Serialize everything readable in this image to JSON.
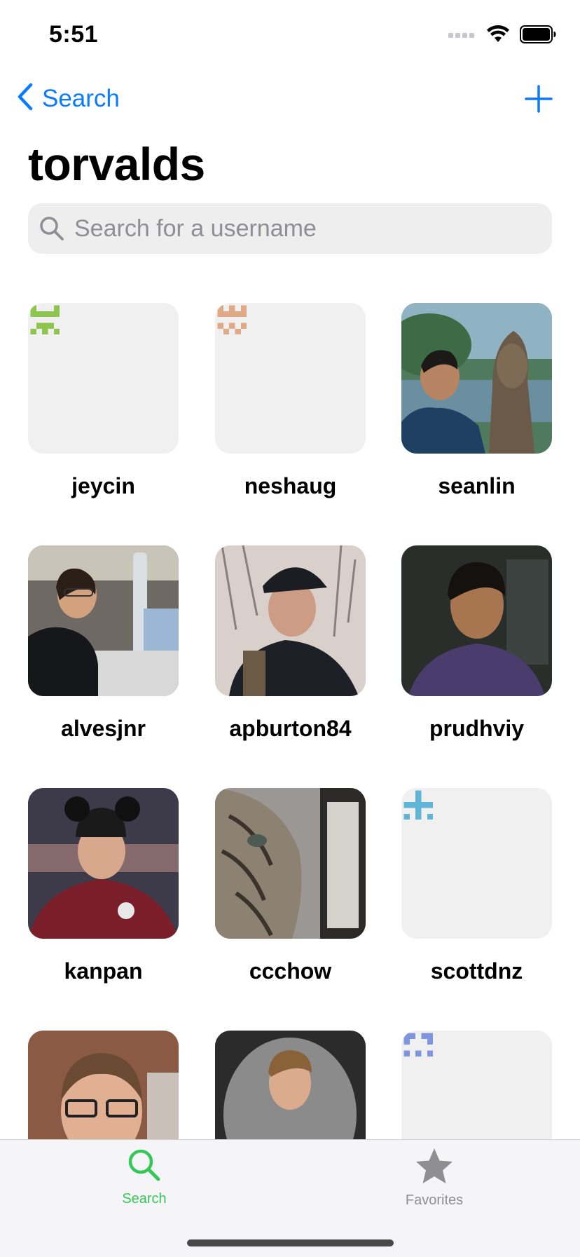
{
  "status_bar": {
    "time": "5:51"
  },
  "nav": {
    "back_label": "Search",
    "title": "torvalds"
  },
  "search": {
    "placeholder": "Search for a username",
    "value": ""
  },
  "users": [
    {
      "username": "jeycin",
      "avatar": "identicon-green"
    },
    {
      "username": "neshaug",
      "avatar": "identicon-tan"
    },
    {
      "username": "seanlin",
      "avatar": "photo"
    },
    {
      "username": "alvesjnr",
      "avatar": "photo"
    },
    {
      "username": "apburton84",
      "avatar": "photo"
    },
    {
      "username": "prudhviy",
      "avatar": "photo"
    },
    {
      "username": "kanpan",
      "avatar": "photo"
    },
    {
      "username": "ccchow",
      "avatar": "photo"
    },
    {
      "username": "scottdnz",
      "avatar": "identicon-blue"
    },
    {
      "username": "",
      "avatar": "photo"
    },
    {
      "username": "",
      "avatar": "photo"
    },
    {
      "username": "",
      "avatar": "identicon-periwinkle"
    }
  ],
  "tab_bar": {
    "search_label": "Search",
    "favorites_label": "Favorites",
    "active_color": "#34c759",
    "inactive_color": "#8e8e93"
  },
  "colors": {
    "accent": "#0a7aff",
    "identicon_green": "#8ec54f",
    "identicon_tan": "#e0aa86",
    "identicon_blue": "#5fb5d5",
    "identicon_periwinkle": "#7f95df"
  }
}
